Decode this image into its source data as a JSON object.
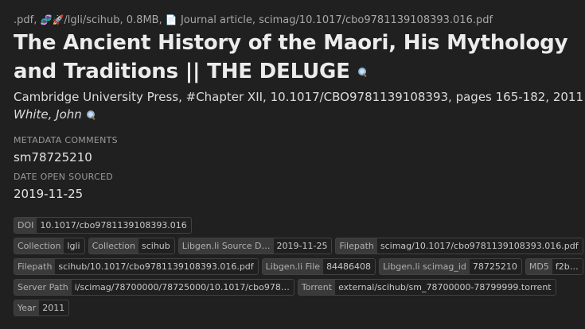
{
  "header": {
    "ext": ".pdf",
    "sep1": ", ",
    "sources": "/lgli/scihub",
    "size": ", 0.8MB, ",
    "type": "Journal article",
    "path": ", scimag/10.1017/cbo9781139108393.016.pdf"
  },
  "title": {
    "text": "The Ancient History of the Maori, His Mythology and Traditions || THE DELUGE"
  },
  "publication": "Cambridge University Press, #Chapter XII, 10.1017/CBO9781139108393, pages 165-182, 2011",
  "author": "White, John",
  "metadata_comments": {
    "label": "METADATA COMMENTS",
    "value": "sm78725210"
  },
  "date_open_sourced": {
    "label": "DATE OPEN SOURCED",
    "value": "2019-11-25"
  },
  "tags": {
    "rows": [
      [
        {
          "k": "DOI",
          "v": "10.1017/cbo9781139108393.016"
        }
      ],
      [
        {
          "k": "Collection",
          "v": "lgli"
        },
        {
          "k": "Collection",
          "v": "scihub"
        },
        {
          "k": "Libgen.li Source D…",
          "v": "2019-11-25"
        },
        {
          "k": "Filepath",
          "v": "scimag/10.1017/cbo9781139108393.016.pdf"
        }
      ],
      [
        {
          "k": "Filepath",
          "v": "scihub/10.1017/cbo9781139108393.016.pdf"
        },
        {
          "k": "Libgen.li File",
          "v": "84486408"
        },
        {
          "k": "Libgen.li scimag_id",
          "v": "78725210"
        },
        {
          "k": "MD5",
          "v": "f2b…"
        }
      ],
      [
        {
          "k": "Server Path",
          "v": "i/scimag/78700000/78725000/10.1017/cbo978…"
        },
        {
          "k": "Torrent",
          "v": "external/scihub/sm_78700000-78799999.torrent"
        }
      ],
      [
        {
          "k": "Year",
          "v": "2011"
        }
      ]
    ]
  },
  "icons": {
    "dna": "dna-icon",
    "rocket": "rocket-icon",
    "document": "document-icon",
    "search": "search-icon"
  }
}
